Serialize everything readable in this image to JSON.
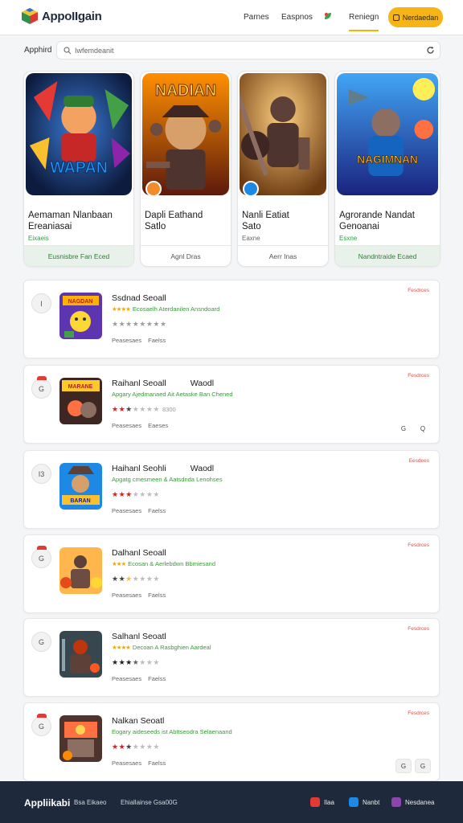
{
  "header": {
    "logo_text": "AppoIIgain",
    "nav": [
      "Parnes",
      "Easpnos",
      "Reniegn"
    ],
    "button_label": "Nerdaedan"
  },
  "search": {
    "label": "Apphird",
    "placeholder": "Iwfemdeanit"
  },
  "featured": [
    {
      "title": "Aemaman Nlanbaan",
      "title2": "Ereaniasai",
      "sub": "Eixaeis",
      "button": "Eusnisbre Fan Eced",
      "art_text": "WAPAN"
    },
    {
      "title": "Dapli Eathand",
      "title2": "Satlo",
      "sub": "",
      "button": "Agnl Dras",
      "art_text": "NADIAN"
    },
    {
      "title": "Nanli Eatiat",
      "title2": "Sato",
      "sub": "Eaxne",
      "button": "Aerr Inas",
      "art_text": ""
    },
    {
      "title": "Agrorande Nandat",
      "title2": "Genoanai",
      "sub": "Esxne",
      "button": "Nandntraide Ecaed",
      "art_text": "NAGIMNAN"
    }
  ],
  "list": [
    {
      "circle": "I",
      "title": "Ssdnad Seoall",
      "extra": "",
      "desc": "Ecosaelh Aterdanilen Ansndoard",
      "stars": "★★★★★★★★",
      "count": "",
      "meta1": "Peasesaes",
      "meta2": "Faelss",
      "badge": "Fesdrces",
      "thumb_text": "NAGDAN"
    },
    {
      "circle": "G",
      "title": "Raihanl Seoall",
      "extra": "Waodl",
      "desc": "Apgary Ajedmanaed Ait Aetaske Ban Chened",
      "stars": "★★★★★★★",
      "count": "8300",
      "meta1": "Peasesaes",
      "meta2": "Eaeses",
      "badge": "Fesdrces",
      "thumb_text": "MARANE"
    },
    {
      "circle": "I3",
      "title": "Haihanl Seohli",
      "extra": "Waodl",
      "desc": "Apgatg cmesmeen & Aatsdnda Lenohses",
      "stars": "★★★★★★★",
      "count": "",
      "meta1": "Peasesaes",
      "meta2": "Faelss",
      "badge": "Eesdees",
      "thumb_text": "BARAN"
    },
    {
      "circle": "G",
      "title": "Dalhanl Seoall",
      "extra": "",
      "desc": "Ecosan & Aerlebdwn Bbmiesand",
      "stars": "★★★★★★★★",
      "count": "",
      "meta1": "Peasesaes",
      "meta2": "Faelss",
      "badge": "Fesdrces",
      "thumb_text": ""
    },
    {
      "circle": "G",
      "title": "Salhanl Seoatl",
      "extra": "",
      "desc": "Decoan A Rasbghien Aardeal",
      "stars": "★★★★★★★",
      "count": "",
      "meta1": "Peasesaes",
      "meta2": "Faelss",
      "badge": "Fesdrces",
      "thumb_text": ""
    },
    {
      "circle": "G",
      "title": "Nalkan Seoatl",
      "extra": "",
      "desc": "Eogary aideseeds ist Abttseodra Selaenaand",
      "stars": "★★★★★★★",
      "count": "",
      "meta1": "Peasesaes",
      "meta2": "Faelss",
      "badge": "Fesdrces",
      "thumb_text": ""
    }
  ],
  "list_actions": {
    "card2": [
      "G",
      "Q"
    ],
    "card6": [
      "G",
      "G"
    ]
  },
  "footer": {
    "brand": "Appliikabi",
    "links": [
      "Bsa Eikaeo",
      "Ehiallainse Gsa00G"
    ],
    "social": [
      "Ilaa",
      "Nanbt",
      "Nesdanea"
    ]
  }
}
